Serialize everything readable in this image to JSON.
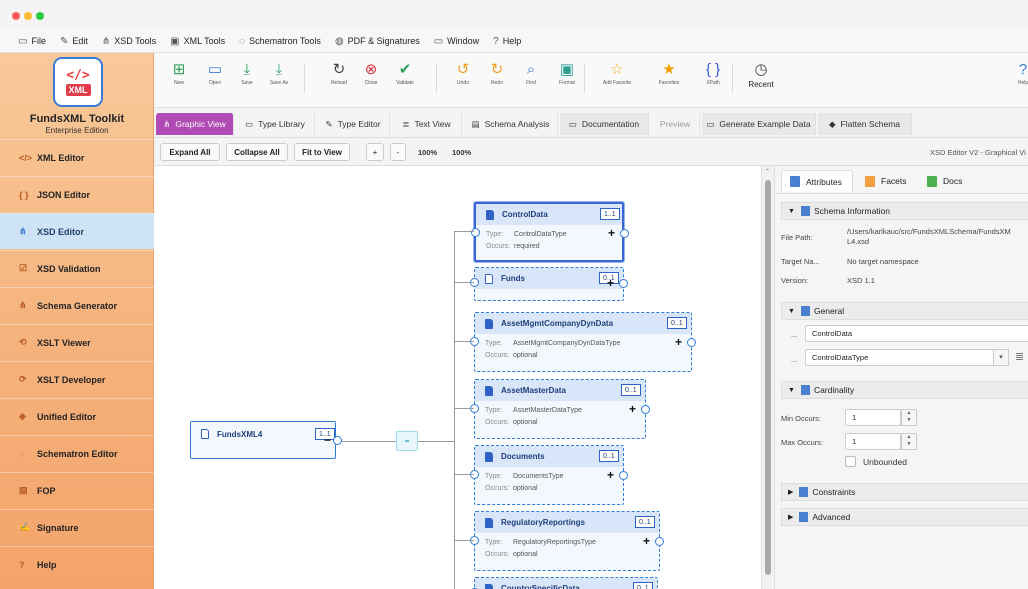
{
  "menu": [
    {
      "icon": "folder-icon",
      "glyph": "▭",
      "label": "File"
    },
    {
      "icon": "pencil-icon",
      "glyph": "✎",
      "label": "Edit"
    },
    {
      "icon": "tree-icon",
      "glyph": "⋔",
      "label": "XSD Tools"
    },
    {
      "icon": "xml-doc-icon",
      "glyph": "▣",
      "label": "XML Tools"
    },
    {
      "icon": "shield-icon",
      "glyph": "◌",
      "label": "Schematron Tools"
    },
    {
      "icon": "shield-check-icon",
      "glyph": "◍",
      "label": "PDF & Signatures"
    },
    {
      "icon": "window-icon",
      "glyph": "▭",
      "label": "Window"
    },
    {
      "icon": "help-icon",
      "glyph": "?",
      "label": "Help"
    }
  ],
  "brand": {
    "title": "FundsXML Toolkit",
    "subtitle": "Enterprise Edition",
    "logo_code": "</>",
    "logo_tag": "XML"
  },
  "nav": [
    {
      "name": "nav-xml-editor",
      "icon": "code-icon",
      "glyph": "</>",
      "label": "XML Editor"
    },
    {
      "name": "nav-json-editor",
      "icon": "braces-icon",
      "glyph": "{ }",
      "label": "JSON Editor"
    },
    {
      "name": "nav-xsd-editor",
      "icon": "tree-icon",
      "glyph": "⋔",
      "label": "XSD Editor",
      "active": true
    },
    {
      "name": "nav-xsd-validation",
      "icon": "check-box-icon",
      "glyph": "☑",
      "label": "XSD Validation"
    },
    {
      "name": "nav-schema-generator",
      "icon": "hierarchy-icon",
      "glyph": "⋔",
      "label": "Schema Generator"
    },
    {
      "name": "nav-xslt-viewer",
      "icon": "transform-icon",
      "glyph": "⟲",
      "label": "XSLT Viewer"
    },
    {
      "name": "nav-xslt-developer",
      "icon": "refresh-icon",
      "glyph": "⟳",
      "label": "XSLT Developer"
    },
    {
      "name": "nav-unified-editor",
      "icon": "layers-icon",
      "glyph": "◈",
      "label": "Unified Editor"
    },
    {
      "name": "nav-schematron-editor",
      "icon": "shield-icon",
      "glyph": "◌",
      "label": "Schematron Editor"
    },
    {
      "name": "nav-fop",
      "icon": "pdf-icon",
      "glyph": "▤",
      "label": "FOP"
    },
    {
      "name": "nav-signature",
      "icon": "signature-icon",
      "glyph": "✍",
      "label": "Signature"
    },
    {
      "name": "nav-help",
      "icon": "help-icon",
      "glyph": "?",
      "label": "Help"
    }
  ],
  "toolbar": [
    {
      "name": "new-button",
      "icon": "new-file-icon",
      "glyph": "⊞",
      "label": "New",
      "color": "#2e9e5b"
    },
    {
      "name": "open-button",
      "icon": "folder-icon",
      "glyph": "▭",
      "label": "Open",
      "color": "#3a7bd5"
    },
    {
      "name": "save-button",
      "icon": "save-icon",
      "glyph": "⤓",
      "label": "Save",
      "color": "#2e9e5b"
    },
    {
      "name": "save-as-button",
      "icon": "save-as-icon",
      "glyph": "⤓",
      "label": "Save As",
      "color": "#3a9e8e"
    },
    {
      "name": "reload-button",
      "icon": "reload-icon",
      "glyph": "↻",
      "label": "Reload",
      "color": "#444"
    },
    {
      "name": "close-button",
      "icon": "close-icon",
      "glyph": "⊗",
      "label": "Close",
      "color": "#d8343a"
    },
    {
      "name": "validate-button",
      "icon": "check-circle-icon",
      "glyph": "✔",
      "label": "Validate",
      "color": "#2e9e5b"
    },
    {
      "name": "undo-button",
      "icon": "undo-icon",
      "glyph": "↺",
      "label": "Undo",
      "color": "#f0a020"
    },
    {
      "name": "redo-button",
      "icon": "redo-icon",
      "glyph": "↻",
      "label": "Redo",
      "color": "#f0a020"
    },
    {
      "name": "find-button",
      "icon": "search-icon",
      "glyph": "⌕",
      "label": "Find",
      "color": "#3a7bd5"
    },
    {
      "name": "format-button",
      "icon": "format-icon",
      "glyph": "▣",
      "label": "Format",
      "color": "#2e9e8e"
    },
    {
      "name": "add-favorite-button",
      "icon": "star-outline-icon",
      "glyph": "☆",
      "label": "Add Favorite",
      "color": "#f0b020"
    },
    {
      "name": "favorites-button",
      "icon": "star-icon",
      "glyph": "★",
      "label": "Favorites",
      "color": "#f0a000"
    },
    {
      "name": "xpath-button",
      "icon": "braces-icon",
      "glyph": "{ }",
      "label": "XPath",
      "color": "#3a5bd5"
    },
    {
      "name": "recent-button",
      "icon": "clock-icon",
      "glyph": "◷",
      "label": "Recent",
      "color": "#444"
    },
    {
      "name": "help-button",
      "icon": "help-icon",
      "glyph": "?",
      "label": "Help",
      "color": "#3a7bd5"
    }
  ],
  "tabs": [
    {
      "name": "tab-graphic-view",
      "icon": "graph-icon",
      "glyph": "⋔",
      "label": "Graphic View",
      "active": true
    },
    {
      "name": "tab-type-library",
      "icon": "library-icon",
      "glyph": "▭",
      "label": "Type Library"
    },
    {
      "name": "tab-type-editor",
      "icon": "edit-icon",
      "glyph": "✎",
      "label": "Type Editor"
    },
    {
      "name": "tab-text-view",
      "icon": "text-icon",
      "glyph": "≣",
      "label": "Text View"
    },
    {
      "name": "tab-schema-analysis",
      "icon": "analysis-icon",
      "glyph": "▤",
      "label": "Schema Analysis"
    },
    {
      "name": "tab-documentation",
      "icon": "doc-icon",
      "glyph": "▭",
      "label": "Documentation",
      "dark": true
    },
    {
      "name": "tab-preview",
      "icon": "",
      "glyph": "",
      "label": "Preview",
      "preview": true
    },
    {
      "name": "tab-generate-example",
      "icon": "example-icon",
      "glyph": "▭",
      "label": "Generate Example Data",
      "dark": true
    },
    {
      "name": "tab-flatten-schema",
      "icon": "flatten-icon",
      "glyph": "◆",
      "label": "Flatten Schema",
      "dark": true
    }
  ],
  "subbar": {
    "expand": "Expand All",
    "collapse": "Collapse All",
    "fit": "Fit to View",
    "plus": "+",
    "minus": "-",
    "zoom": "100%",
    "zoom2": "100%",
    "status": "XSD Editor V2 - Graphical Vi"
  },
  "root": {
    "name": "FundsXML4",
    "badge": "1..1"
  },
  "nodes": [
    {
      "name": "ControlData",
      "badge": "1..1",
      "type": "ControlDataType",
      "occurs": "required",
      "solid": true,
      "sel": true
    },
    {
      "name": "Funds",
      "badge": "0..1",
      "type": "",
      "occurs": "",
      "outline": true
    },
    {
      "name": "AssetMgmtCompanyDynData",
      "badge": "0..1",
      "type": "AssetMgmtCompanyDynDataType",
      "occurs": "optional"
    },
    {
      "name": "AssetMasterData",
      "badge": "0..1",
      "type": "AssetMasterDataType",
      "occurs": "optional"
    },
    {
      "name": "Documents",
      "badge": "0..1",
      "type": "DocumentsType",
      "occurs": "optional"
    },
    {
      "name": "RegulatoryReportings",
      "badge": "0..1",
      "type": "RegulatoryReportingsType",
      "occurs": "optional"
    },
    {
      "name": "CountrySpecificData",
      "badge": "0..1",
      "type": "",
      "occurs": ""
    }
  ],
  "labels": {
    "type": "Type:",
    "occurs": "Occurs:"
  },
  "rtabs": [
    {
      "label": "Attributes",
      "color": "#4a7fd0",
      "active": true
    },
    {
      "label": "Facets",
      "color": "#f0a040"
    },
    {
      "label": "Docs",
      "color": "#4caf50"
    }
  ],
  "schema_info": {
    "title": "Schema Information",
    "file_path_label": "File Path:",
    "file_path": "/Users/karlkauc/src/FundsXMLSchema/FundsXM",
    "file_path2": "L4.xsd",
    "target_label": "Target Na...",
    "target": "No target namespace",
    "version_label": "Version:",
    "version": "XSD 1.1"
  },
  "general": {
    "title": "General",
    "dots": "...",
    "name": "ControlData",
    "type": "ControlDataType"
  },
  "cardinality": {
    "title": "Cardinality",
    "min_label": "Min Occurs:",
    "min": "1",
    "max_label": "Max Occurs:",
    "max": "1",
    "unbounded": "Unbounded"
  },
  "constraints": {
    "title": "Constraints"
  },
  "advanced": {
    "title": "Advanced"
  }
}
